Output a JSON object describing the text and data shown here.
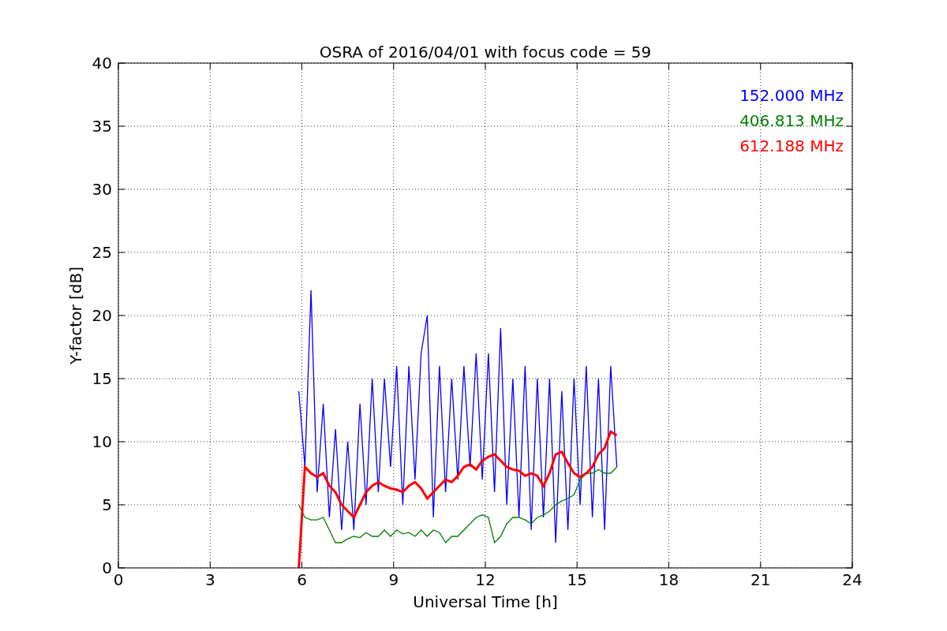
{
  "chart_data": {
    "type": "line",
    "grid": true,
    "title": "OSRA of 2016/04/01 with focus code = 59",
    "xlabel": "Universal Time [h]",
    "ylabel": "Y-factor [dB]",
    "xlim": [
      0,
      24
    ],
    "ylim": [
      0,
      40
    ],
    "xticks": [
      0,
      3,
      6,
      9,
      12,
      15,
      18,
      21,
      24
    ],
    "yticks": [
      0,
      5,
      10,
      15,
      20,
      25,
      30,
      35,
      40
    ],
    "x": [
      5.9,
      6.1,
      6.3,
      6.5,
      6.7,
      6.9,
      7.1,
      7.3,
      7.5,
      7.7,
      7.9,
      8.1,
      8.3,
      8.5,
      8.7,
      8.9,
      9.1,
      9.3,
      9.5,
      9.7,
      9.9,
      10.1,
      10.3,
      10.5,
      10.7,
      10.9,
      11.1,
      11.3,
      11.5,
      11.7,
      11.9,
      12.1,
      12.3,
      12.5,
      12.7,
      12.9,
      13.1,
      13.3,
      13.5,
      13.7,
      13.9,
      14.1,
      14.3,
      14.5,
      14.7,
      14.9,
      15.1,
      15.3,
      15.5,
      15.7,
      15.9,
      16.1,
      16.3
    ],
    "series": [
      {
        "name": "152.000 MHz",
        "color": "#0000ff",
        "values": [
          14,
          8,
          22,
          6,
          13,
          4,
          11,
          3,
          10,
          3,
          13,
          5,
          15,
          6,
          15,
          8,
          16,
          5,
          16,
          7,
          17,
          20,
          4,
          16,
          6,
          15,
          7,
          16,
          8,
          17,
          7,
          17,
          6,
          19,
          5,
          15,
          4,
          16,
          3,
          15,
          4,
          15,
          2,
          14,
          3,
          15,
          5,
          16,
          4,
          15,
          3,
          16,
          8
        ]
      },
      {
        "name": "406.813 MHz",
        "color": "#008000",
        "values": [
          5,
          4,
          3.8,
          3.8,
          4,
          3,
          2,
          2,
          2.3,
          2.5,
          2.4,
          2.8,
          2.5,
          2.5,
          3,
          2.5,
          3,
          2.7,
          2.8,
          2.5,
          3,
          2.5,
          3,
          2.8,
          2,
          2.5,
          2.5,
          3,
          3.5,
          4,
          4.2,
          4,
          2,
          2.5,
          3.5,
          4,
          4,
          3.8,
          3.5,
          4,
          4.2,
          4.5,
          5,
          5.3,
          5.5,
          5.8,
          7,
          7.5,
          7.5,
          7.8,
          7.5,
          7.5,
          8
        ]
      },
      {
        "name": "612.188 MHz",
        "color": "#ff0000",
        "values": [
          0,
          8,
          7.5,
          7.2,
          7.5,
          6.5,
          6,
          5,
          4.5,
          4,
          5,
          6,
          6.5,
          6.8,
          6.5,
          6.3,
          6.2,
          6,
          6.5,
          6.8,
          6.3,
          5.5,
          6,
          6.5,
          7,
          6.8,
          7.3,
          8,
          8.2,
          7.8,
          8.5,
          8.8,
          9,
          8.5,
          8,
          7.8,
          7.7,
          7.3,
          7.5,
          7.3,
          6.5,
          7.5,
          9,
          9.2,
          8.3,
          7.5,
          7.2,
          7.5,
          8,
          9,
          9.5,
          10.8,
          10.5
        ]
      }
    ]
  }
}
